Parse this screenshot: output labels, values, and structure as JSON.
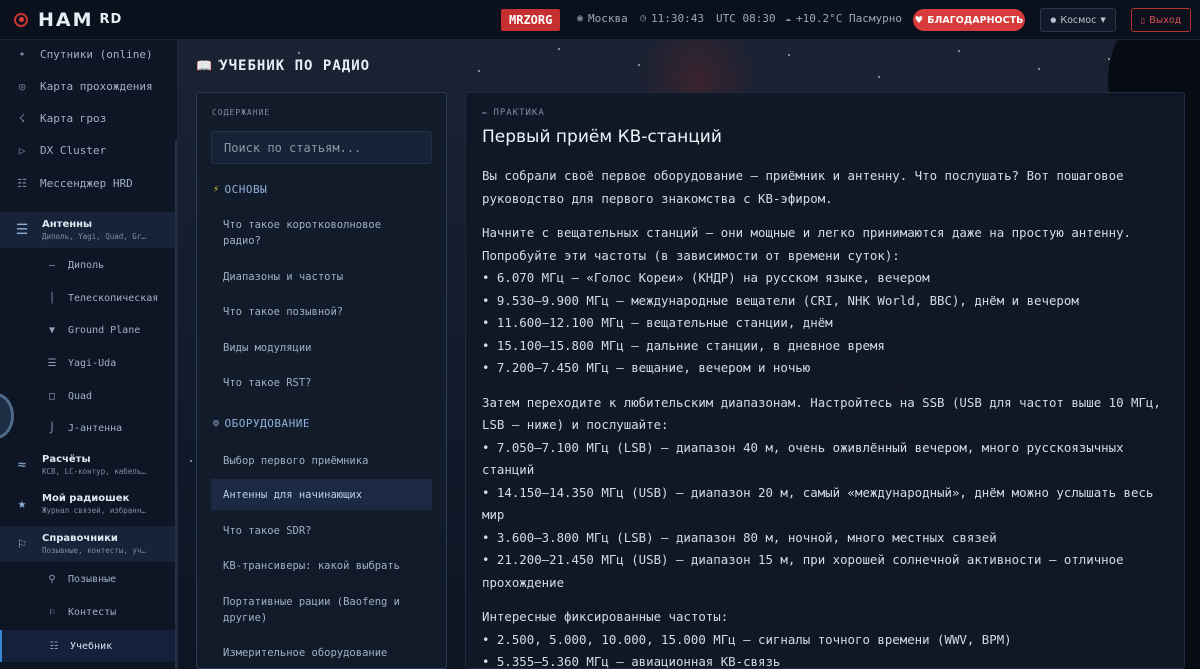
{
  "header": {
    "logo_text": "HAM",
    "logo_suffix": "RD",
    "callsign": "MRZORG",
    "city": "Москва",
    "local_time": "11:30:43",
    "utc_time": "UTC 08:30",
    "weather": "+10.2°C Пасмурно",
    "thanks_label": "БЛАГОДАРНОСТЬ",
    "theme_label": "Космос",
    "logout_label": "Выход"
  },
  "sidebar": {
    "items": [
      {
        "label": "Спутники (online)",
        "icon": "satellite-icon"
      },
      {
        "label": "Карта прохождения",
        "icon": "target-icon"
      },
      {
        "label": "Карта гроз",
        "icon": "lightning-icon"
      },
      {
        "label": "DX Cluster",
        "icon": "play-icon"
      },
      {
        "label": "Мессенджер HRD",
        "icon": "grid-icon"
      }
    ],
    "antennas": {
      "title": "Антенны",
      "subtitle": "Диполь, Yagi, Quad, Gr…",
      "children": [
        "Диполь",
        "Телескопическая",
        "Ground Plane",
        "Yagi-Uda",
        "Quad",
        "J-антенна"
      ]
    },
    "calcs": {
      "title": "Расчёты",
      "subtitle": "КСВ, LC-контур, кабель…"
    },
    "myradio": {
      "title": "Мой радиошек",
      "subtitle": "Журнал связей, избранн…"
    },
    "refs": {
      "title": "Справочники",
      "subtitle": "Позывные, контесты, уч…",
      "children": [
        "Позывные",
        "Контесты",
        "Учебник"
      ]
    }
  },
  "page": {
    "title": "УЧЕБНИК ПО РАДИО"
  },
  "toc": {
    "heading": "СОДЕРЖАНИЕ",
    "search_placeholder": "Поиск по статьям...",
    "sections": [
      {
        "title": "ОСНОВЫ",
        "links": [
          "Что такое коротковолновое радио?",
          "Диапазоны и частоты",
          "Что такое позывной?",
          "Виды модуляции",
          "Что такое RST?"
        ]
      },
      {
        "title": "ОБОРУДОВАНИЕ",
        "links": [
          "Выбор первого приёмника",
          "Антенны для начинающих",
          "Что такое SDR?",
          "КВ-трансиверы: какой выбрать",
          "Портативные рации (Baofeng и другие)",
          "Измерительное оборудование"
        ]
      }
    ]
  },
  "article": {
    "category": "ПРАКТИКА",
    "title": "Первый приём КВ-станций",
    "paragraphs": [
      [
        "Вы собрали своё первое оборудование — приёмник и антенну. Что послушать? Вот пошаговое руководство для первого знакомства с КВ-эфиром."
      ],
      [
        "Начните с вещательных станций — они мощные и легко принимаются даже на простую антенну. Попробуйте эти частоты (в зависимости от времени суток):",
        "• 6.070 МГц — «Голос Кореи» (КНДР) на русском языке, вечером",
        "• 9.530–9.900 МГц — международные вещатели (CRI, NHK World, BBC), днём и вечером",
        "• 11.600–12.100 МГц — вещательные станции, днём",
        "• 15.100–15.800 МГц — дальние станции, в дневное время",
        "• 7.200–7.450 МГц — вещание, вечером и ночью"
      ],
      [
        "Затем переходите к любительским диапазонам. Настройтесь на SSB (USB для частот выше 10 МГц, LSB — ниже) и послушайте:",
        "• 7.050–7.100 МГц (LSB) — диапазон 40 м, очень оживлённый вечером, много русскоязычных станций",
        "• 14.150–14.350 МГц (USB) — диапазон 20 м, самый «международный», днём можно услышать весь мир",
        "• 3.600–3.800 МГц (LSB) — диапазон 80 м, ночной, много местных связей",
        "• 21.200–21.450 МГц (USB) — диапазон 15 м, при хорошей солнечной активности — отличное прохождение"
      ],
      [
        "Интересные фиксированные частоты:",
        "• 2.500, 5.000, 10.000, 15.000 МГц — сигналы точного времени (WWV, BPM)",
        "• 5.355–5.360 МГц — авиационная КВ-связь"
      ]
    ]
  },
  "colors": {
    "accent_red": "#d83b3b",
    "accent_blue": "#3a86d8",
    "bg": "#0b1220"
  }
}
